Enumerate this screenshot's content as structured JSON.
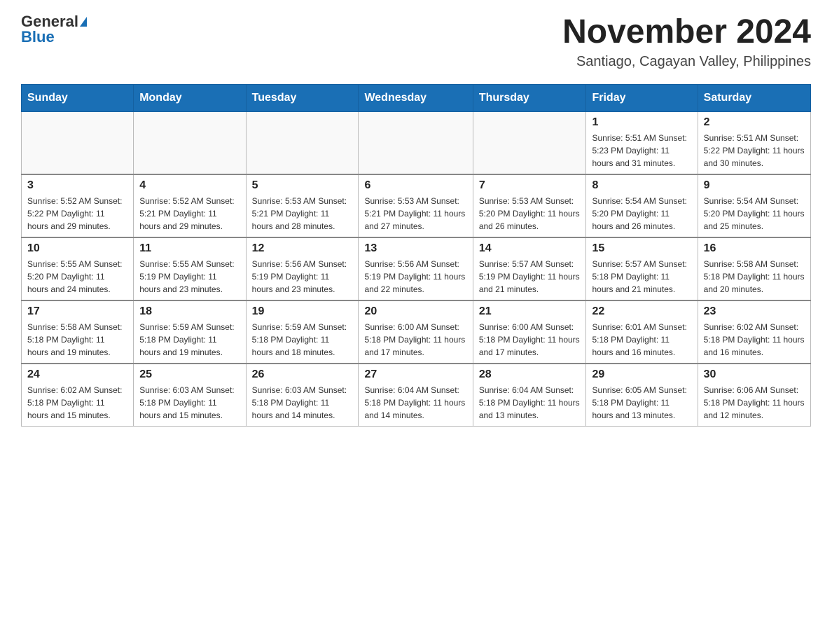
{
  "header": {
    "logo_general": "General",
    "logo_blue": "Blue",
    "month_title": "November 2024",
    "location": "Santiago, Cagayan Valley, Philippines"
  },
  "days_of_week": [
    "Sunday",
    "Monday",
    "Tuesday",
    "Wednesday",
    "Thursday",
    "Friday",
    "Saturday"
  ],
  "weeks": [
    [
      {
        "day": "",
        "info": ""
      },
      {
        "day": "",
        "info": ""
      },
      {
        "day": "",
        "info": ""
      },
      {
        "day": "",
        "info": ""
      },
      {
        "day": "",
        "info": ""
      },
      {
        "day": "1",
        "info": "Sunrise: 5:51 AM\nSunset: 5:23 PM\nDaylight: 11 hours and 31 minutes."
      },
      {
        "day": "2",
        "info": "Sunrise: 5:51 AM\nSunset: 5:22 PM\nDaylight: 11 hours and 30 minutes."
      }
    ],
    [
      {
        "day": "3",
        "info": "Sunrise: 5:52 AM\nSunset: 5:22 PM\nDaylight: 11 hours and 29 minutes."
      },
      {
        "day": "4",
        "info": "Sunrise: 5:52 AM\nSunset: 5:21 PM\nDaylight: 11 hours and 29 minutes."
      },
      {
        "day": "5",
        "info": "Sunrise: 5:53 AM\nSunset: 5:21 PM\nDaylight: 11 hours and 28 minutes."
      },
      {
        "day": "6",
        "info": "Sunrise: 5:53 AM\nSunset: 5:21 PM\nDaylight: 11 hours and 27 minutes."
      },
      {
        "day": "7",
        "info": "Sunrise: 5:53 AM\nSunset: 5:20 PM\nDaylight: 11 hours and 26 minutes."
      },
      {
        "day": "8",
        "info": "Sunrise: 5:54 AM\nSunset: 5:20 PM\nDaylight: 11 hours and 26 minutes."
      },
      {
        "day": "9",
        "info": "Sunrise: 5:54 AM\nSunset: 5:20 PM\nDaylight: 11 hours and 25 minutes."
      }
    ],
    [
      {
        "day": "10",
        "info": "Sunrise: 5:55 AM\nSunset: 5:20 PM\nDaylight: 11 hours and 24 minutes."
      },
      {
        "day": "11",
        "info": "Sunrise: 5:55 AM\nSunset: 5:19 PM\nDaylight: 11 hours and 23 minutes."
      },
      {
        "day": "12",
        "info": "Sunrise: 5:56 AM\nSunset: 5:19 PM\nDaylight: 11 hours and 23 minutes."
      },
      {
        "day": "13",
        "info": "Sunrise: 5:56 AM\nSunset: 5:19 PM\nDaylight: 11 hours and 22 minutes."
      },
      {
        "day": "14",
        "info": "Sunrise: 5:57 AM\nSunset: 5:19 PM\nDaylight: 11 hours and 21 minutes."
      },
      {
        "day": "15",
        "info": "Sunrise: 5:57 AM\nSunset: 5:18 PM\nDaylight: 11 hours and 21 minutes."
      },
      {
        "day": "16",
        "info": "Sunrise: 5:58 AM\nSunset: 5:18 PM\nDaylight: 11 hours and 20 minutes."
      }
    ],
    [
      {
        "day": "17",
        "info": "Sunrise: 5:58 AM\nSunset: 5:18 PM\nDaylight: 11 hours and 19 minutes."
      },
      {
        "day": "18",
        "info": "Sunrise: 5:59 AM\nSunset: 5:18 PM\nDaylight: 11 hours and 19 minutes."
      },
      {
        "day": "19",
        "info": "Sunrise: 5:59 AM\nSunset: 5:18 PM\nDaylight: 11 hours and 18 minutes."
      },
      {
        "day": "20",
        "info": "Sunrise: 6:00 AM\nSunset: 5:18 PM\nDaylight: 11 hours and 17 minutes."
      },
      {
        "day": "21",
        "info": "Sunrise: 6:00 AM\nSunset: 5:18 PM\nDaylight: 11 hours and 17 minutes."
      },
      {
        "day": "22",
        "info": "Sunrise: 6:01 AM\nSunset: 5:18 PM\nDaylight: 11 hours and 16 minutes."
      },
      {
        "day": "23",
        "info": "Sunrise: 6:02 AM\nSunset: 5:18 PM\nDaylight: 11 hours and 16 minutes."
      }
    ],
    [
      {
        "day": "24",
        "info": "Sunrise: 6:02 AM\nSunset: 5:18 PM\nDaylight: 11 hours and 15 minutes."
      },
      {
        "day": "25",
        "info": "Sunrise: 6:03 AM\nSunset: 5:18 PM\nDaylight: 11 hours and 15 minutes."
      },
      {
        "day": "26",
        "info": "Sunrise: 6:03 AM\nSunset: 5:18 PM\nDaylight: 11 hours and 14 minutes."
      },
      {
        "day": "27",
        "info": "Sunrise: 6:04 AM\nSunset: 5:18 PM\nDaylight: 11 hours and 14 minutes."
      },
      {
        "day": "28",
        "info": "Sunrise: 6:04 AM\nSunset: 5:18 PM\nDaylight: 11 hours and 13 minutes."
      },
      {
        "day": "29",
        "info": "Sunrise: 6:05 AM\nSunset: 5:18 PM\nDaylight: 11 hours and 13 minutes."
      },
      {
        "day": "30",
        "info": "Sunrise: 6:06 AM\nSunset: 5:18 PM\nDaylight: 11 hours and 12 minutes."
      }
    ]
  ]
}
